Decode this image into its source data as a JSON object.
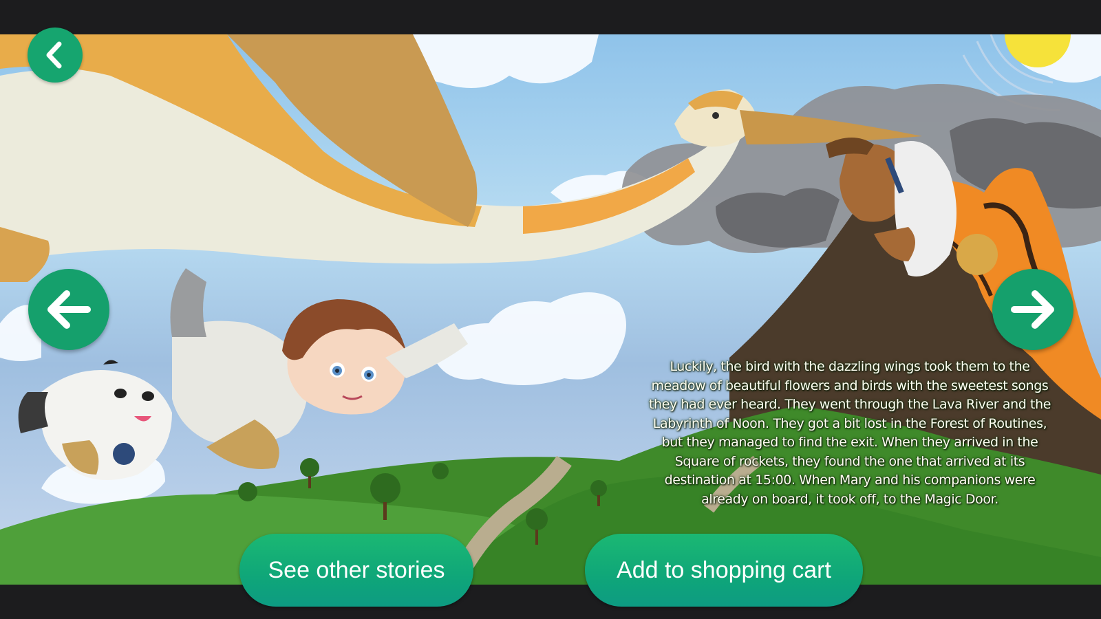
{
  "story": {
    "paragraph_lines": [
      "Luckily, the bird with the dazzling wings took them to the",
      "meadow of beautiful flowers and birds with the sweetest songs",
      "they had ever heard. They went through the Lava River and the",
      "Labyrinth of Noon. They got a bit lost in the Forest of Routines,",
      "but they managed to find the exit. When they arrived in the",
      "Square of rockets, they found the one that arrived at its",
      "destination at 15:00. When Mary and his companions were",
      "already on board, it took off, to the Magic Door."
    ]
  },
  "navigation": {
    "back_icon": "chevron-left-icon",
    "prev_icon": "arrow-left-icon",
    "next_icon": "arrow-right-icon"
  },
  "actions": {
    "see_other_stories": "See other stories",
    "add_to_cart": "Add to shopping cart"
  },
  "colors": {
    "accent_green": "#16a56f",
    "frame_dark": "#1c1c1e"
  }
}
